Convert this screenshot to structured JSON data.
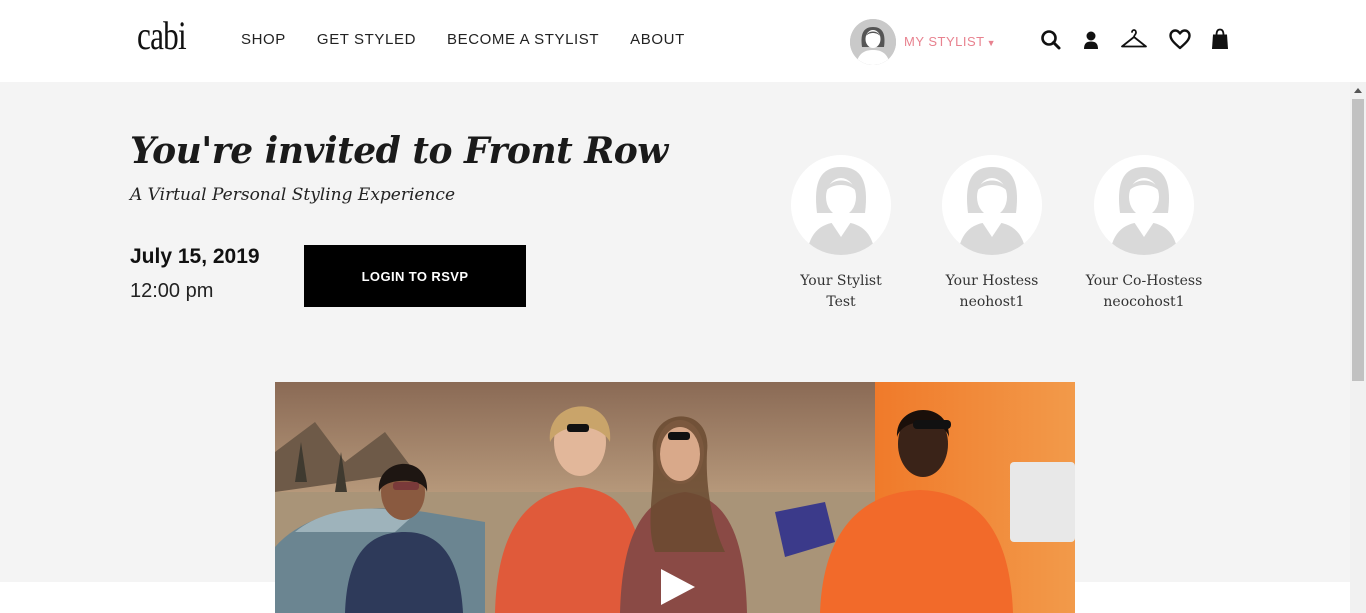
{
  "header": {
    "logo": "cabi",
    "nav": [
      "SHOP",
      "GET STYLED",
      "BECOME A STYLIST",
      "ABOUT"
    ],
    "my_stylist": "MY STYLIST",
    "icons": [
      "search-icon",
      "account-icon",
      "hanger-icon",
      "heart-icon",
      "bag-icon"
    ],
    "accent_color": "#e8828f"
  },
  "hero": {
    "title": "You're invited to Front Row",
    "subtitle": "A Virtual Personal Styling Experience",
    "date": "July 15, 2019",
    "time": "12:00 pm",
    "rsvp_label": "LOGIN TO RSVP"
  },
  "hosts": [
    {
      "role": "Your Stylist",
      "name": "Test"
    },
    {
      "role": "Your Hostess",
      "name": "neohost1"
    },
    {
      "role": "Your Co-Hostess",
      "name": "neocohost1"
    }
  ],
  "video": {
    "icon": "play-icon"
  }
}
